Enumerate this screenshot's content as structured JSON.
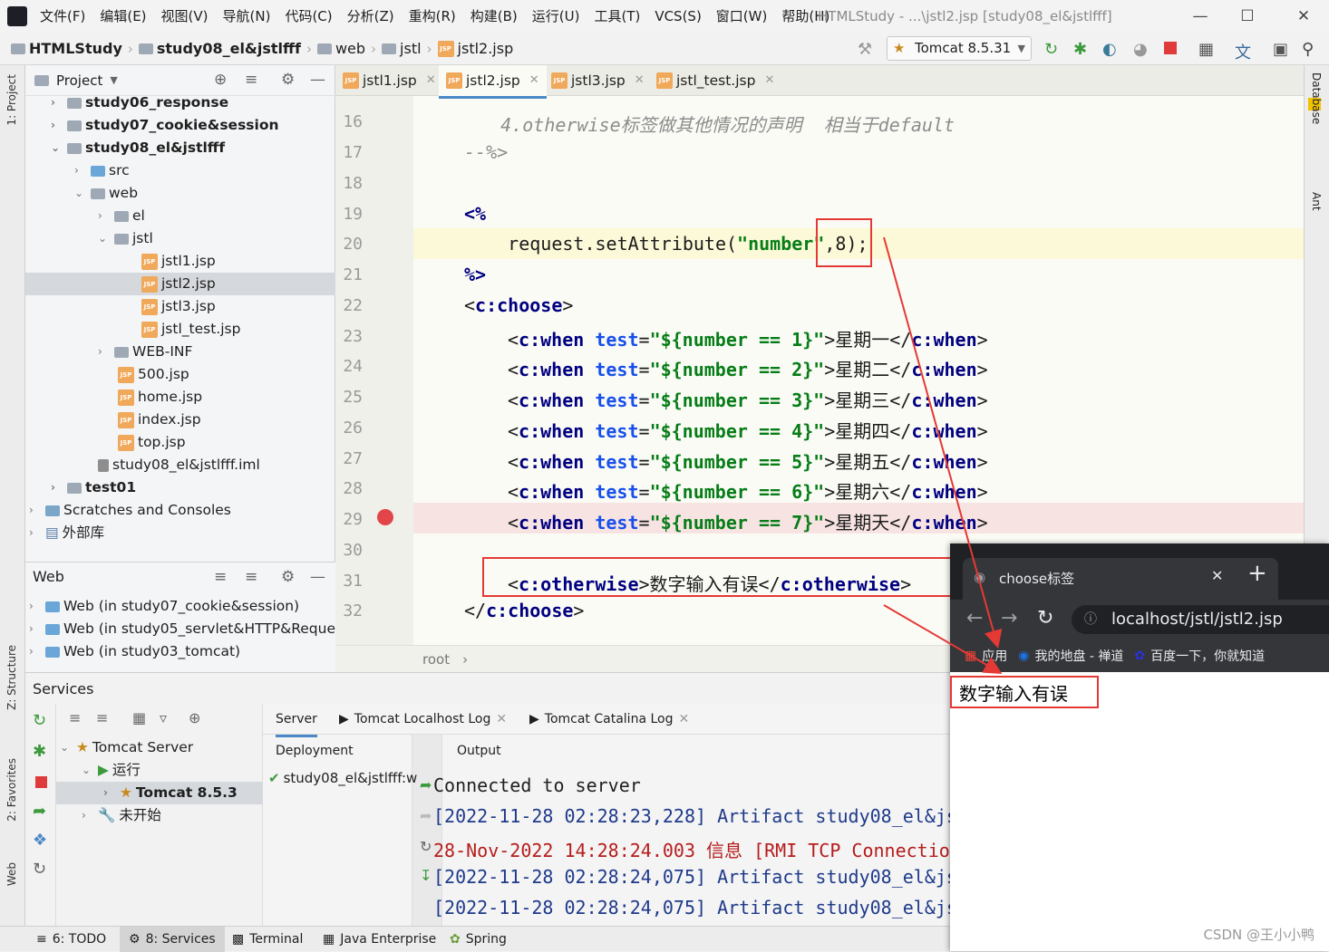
{
  "menubar": {
    "items": [
      "文件(F)",
      "编辑(E)",
      "视图(V)",
      "导航(N)",
      "代码(C)",
      "分析(Z)",
      "重构(R)",
      "构建(B)",
      "运行(U)",
      "工具(T)",
      "VCS(S)",
      "窗口(W)",
      "帮助(H)"
    ],
    "window_title": "HTMLStudy - ...\\jstl2.jsp [study08_el&jstlfff]"
  },
  "navbar": {
    "crumbs": [
      "HTMLStudy",
      "study08_el&jstlfff",
      "web",
      "jstl",
      "jstl2.jsp"
    ],
    "run_config": "Tomcat 8.5.31"
  },
  "left_stripe": {
    "project": "1: Project",
    "structure": "Z: Structure",
    "favorites": "2: Favorites",
    "web": "Web"
  },
  "right_stripe": {
    "database": "Database",
    "ant": "Ant"
  },
  "project": {
    "title": "Project",
    "tree": [
      {
        "label": "study06_response",
        "bold": true
      },
      {
        "label": "study07_cookie&session",
        "bold": true
      },
      {
        "label": "study08_el&jstlfff",
        "bold": true
      },
      {
        "label": "src"
      },
      {
        "label": "web"
      },
      {
        "label": "el"
      },
      {
        "label": "jstl"
      },
      {
        "label": "jstl1.jsp"
      },
      {
        "label": "jstl2.jsp"
      },
      {
        "label": "jstl3.jsp"
      },
      {
        "label": "jstl_test.jsp"
      },
      {
        "label": "WEB-INF"
      },
      {
        "label": "500.jsp"
      },
      {
        "label": "home.jsp"
      },
      {
        "label": "index.jsp"
      },
      {
        "label": "top.jsp"
      },
      {
        "label": "study08_el&jstlfff.iml"
      },
      {
        "label": "test01",
        "bold": true
      },
      {
        "label": "Scratches and Consoles"
      },
      {
        "label": "外部库"
      }
    ]
  },
  "web_panel": {
    "title": "Web",
    "items": [
      "Web (in study07_cookie&session)",
      "Web (in study05_servlet&HTTP&Reques",
      "Web (in study03_tomcat)"
    ]
  },
  "editor": {
    "tabs": [
      "jstl1.jsp",
      "jstl2.jsp",
      "jstl3.jsp",
      "jstl_test.jsp"
    ],
    "line_numbers": [
      "16",
      "17",
      "18",
      "19",
      "20",
      "21",
      "22",
      "23",
      "24",
      "25",
      "26",
      "27",
      "28",
      "29",
      "30",
      "31",
      "32"
    ],
    "lines": {
      "l16": "    4.otherwise标签做其他情况的声明  相当于default",
      "l17": "--%>",
      "l19": "<%",
      "l20a": "    request.setAttribute(",
      "l20b": "\"number\"",
      "l20c": ",8);",
      "l21": "%>",
      "l22a": "<",
      "l22b": "c:choose",
      "l22c": ">",
      "when_prefix": "c:when",
      "when_attr": "test",
      "when_rows": [
        {
          "expr": "\"${number == 1}\"",
          "day": "星期一"
        },
        {
          "expr": "\"${number == 2}\"",
          "day": "星期二"
        },
        {
          "expr": "\"${number == 3}\"",
          "day": "星期三"
        },
        {
          "expr": "\"${number == 4}\"",
          "day": "星期四"
        },
        {
          "expr": "\"${number == 5}\"",
          "day": "星期五"
        },
        {
          "expr": "\"${number == 6}\"",
          "day": "星期六"
        },
        {
          "expr": "\"${number == 7}\"",
          "day": "星期天"
        }
      ],
      "otherwise_tag": "c:otherwise",
      "otherwise_text": "数字输入有误",
      "l32": "c:choose"
    },
    "breadcrumb": "root"
  },
  "services": {
    "title": "Services",
    "tree": [
      "Tomcat Server",
      "运行",
      "Tomcat 8.5.3",
      "未开始"
    ],
    "tabs": [
      "Server",
      "Tomcat Localhost Log",
      "Tomcat Catalina Log"
    ],
    "deployment_header": "Deployment",
    "output_header": "Output",
    "deployment_item": "study08_el&jstlfff:w",
    "console": [
      {
        "text": "Connected to server",
        "color": "#1f1f1f"
      },
      {
        "text": "[2022-11-28 02:28:23,228] Artifact study08_el&js",
        "color": "#1e3a8a"
      },
      {
        "text": "28-Nov-2022 14:28:24.003 信息 [RMI TCP Connectio",
        "color": "#b71c1c"
      },
      {
        "text": "[2022-11-28 02:28:24,075] Artifact study08_el&js",
        "color": "#1e3a8a"
      },
      {
        "text": "[2022-11-28 02:28:24,075] Artifact study08_el&js",
        "color": "#1e3a8a"
      }
    ]
  },
  "bottombar": {
    "tabs": [
      "6: TODO",
      "8: Services",
      "Terminal",
      "Java Enterprise",
      "Spring"
    ]
  },
  "browser": {
    "tab_title": "choose标签",
    "url": "localhost/jstl/jstl2.jsp",
    "bookmarks": [
      "应用",
      "我的地盘 - 禅道",
      "百度一下，你就知道"
    ],
    "content": "数字输入有误"
  },
  "watermark": "CSDN @王小小鸭",
  "colors": {
    "highlight_red": "#e53935",
    "accent_blue": "#4a88c7"
  }
}
